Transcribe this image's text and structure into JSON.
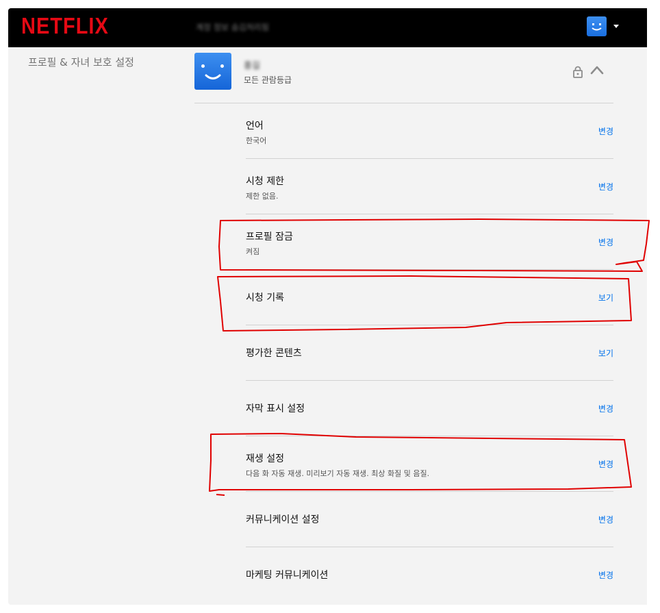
{
  "header": {
    "logo": "NETFLIX",
    "blurred_text": "계정 정보 숨김처리됨"
  },
  "sidebar": {
    "title": "프로필 & 자녀 보호 설정"
  },
  "profile": {
    "name": "홍길",
    "rating": "모든 관람등급"
  },
  "settings": [
    {
      "label": "언어",
      "desc": "한국어",
      "action": "변경"
    },
    {
      "label": "시청 제한",
      "desc": "제한 없음.",
      "action": "변경"
    },
    {
      "label": "프로필 잠금",
      "desc": "켜짐",
      "action": "변경"
    },
    {
      "label": "시청 기록",
      "desc": "",
      "action": "보기"
    },
    {
      "label": "평가한 콘텐츠",
      "desc": "",
      "action": "보기"
    },
    {
      "label": "자막 표시 설정",
      "desc": "",
      "action": "변경"
    },
    {
      "label": "재생 설정",
      "desc": "다음 화 자동 재생. 미리보기 자동 재생. 최상 화질 및 음질.",
      "action": "변경"
    },
    {
      "label": "커뮤니케이션 설정",
      "desc": "",
      "action": "변경"
    },
    {
      "label": "마케팅 커뮤니케이션",
      "desc": "",
      "action": "변경"
    }
  ],
  "colors": {
    "brand": "#e50914",
    "link": "#0071eb",
    "annotation": "#e00000"
  }
}
